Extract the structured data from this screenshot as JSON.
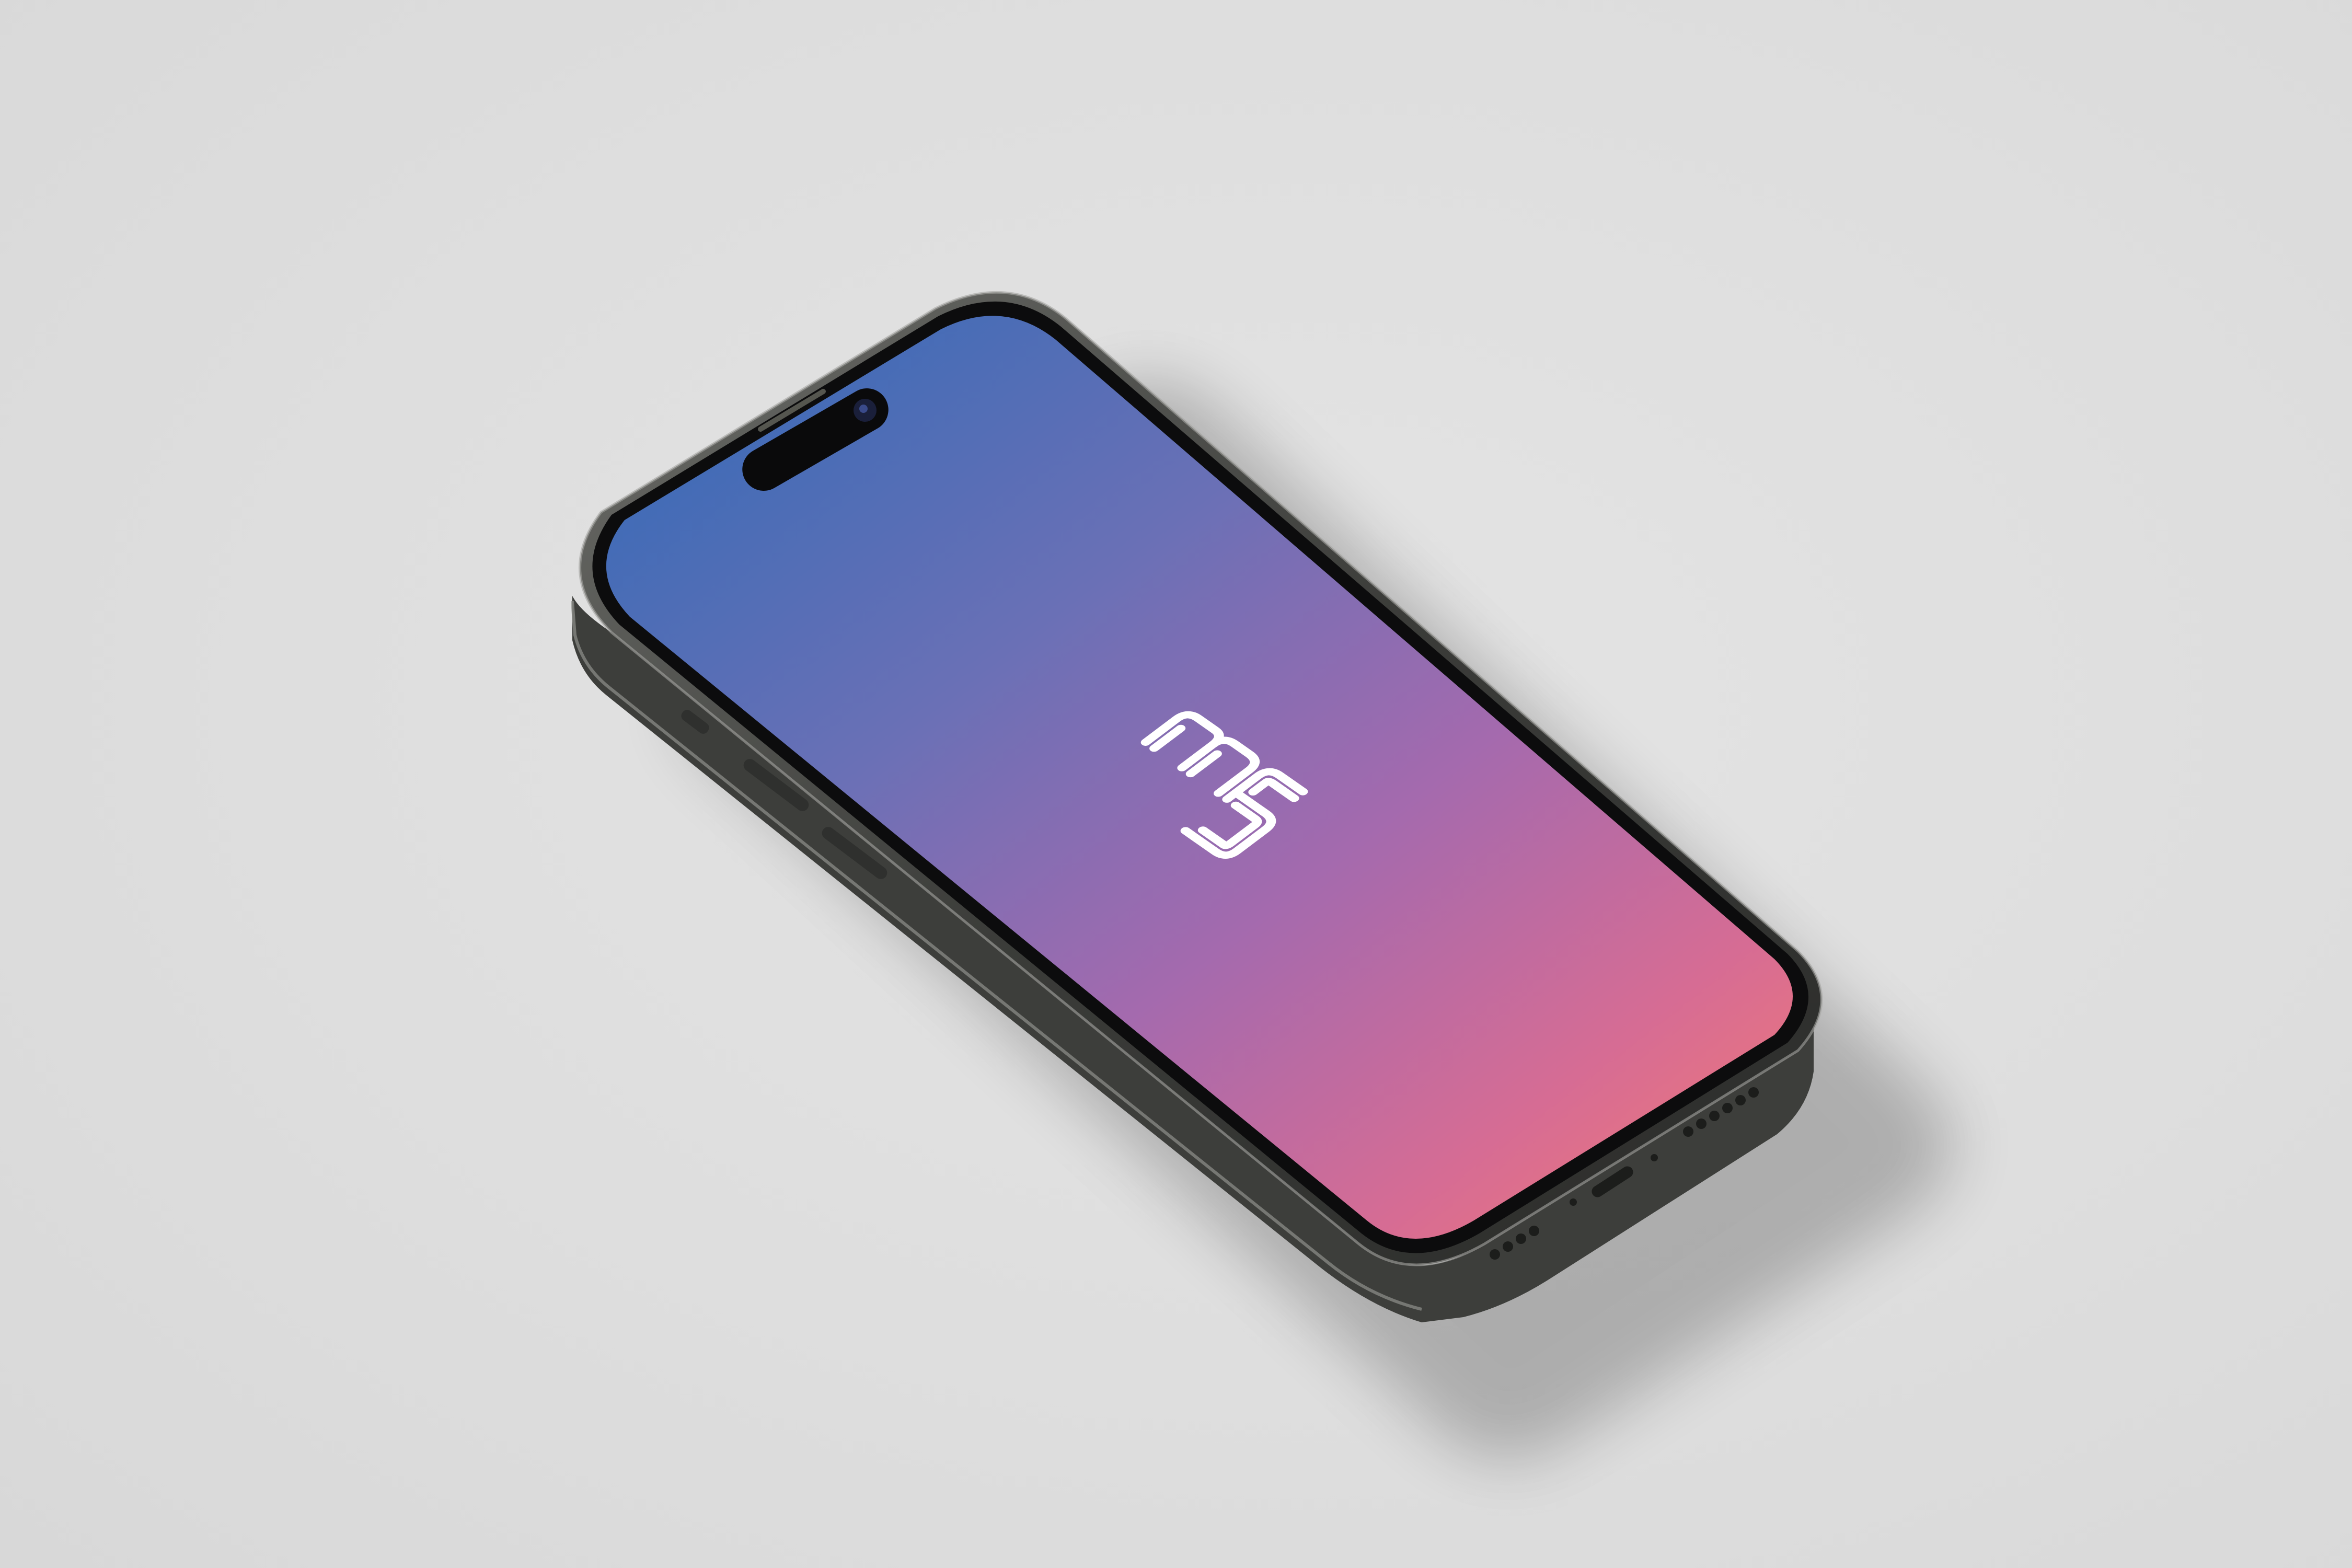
{
  "scene": {
    "background_color": "#dedede",
    "device": "smartphone",
    "screen_state": "splash-screen",
    "logo_icon": "ms-monogram-icon"
  },
  "colors": {
    "frame": "#3a3b38",
    "frame_highlight": "#9a9b97",
    "bezel": "#0c0c0d",
    "dynamic_island": "#0a0a0b",
    "wallpaper_top": "#3a6cb5",
    "wallpaper_mid": "#8a6ab0",
    "wallpaper_bottom": "#f27575",
    "logo": "#ffffff"
  }
}
